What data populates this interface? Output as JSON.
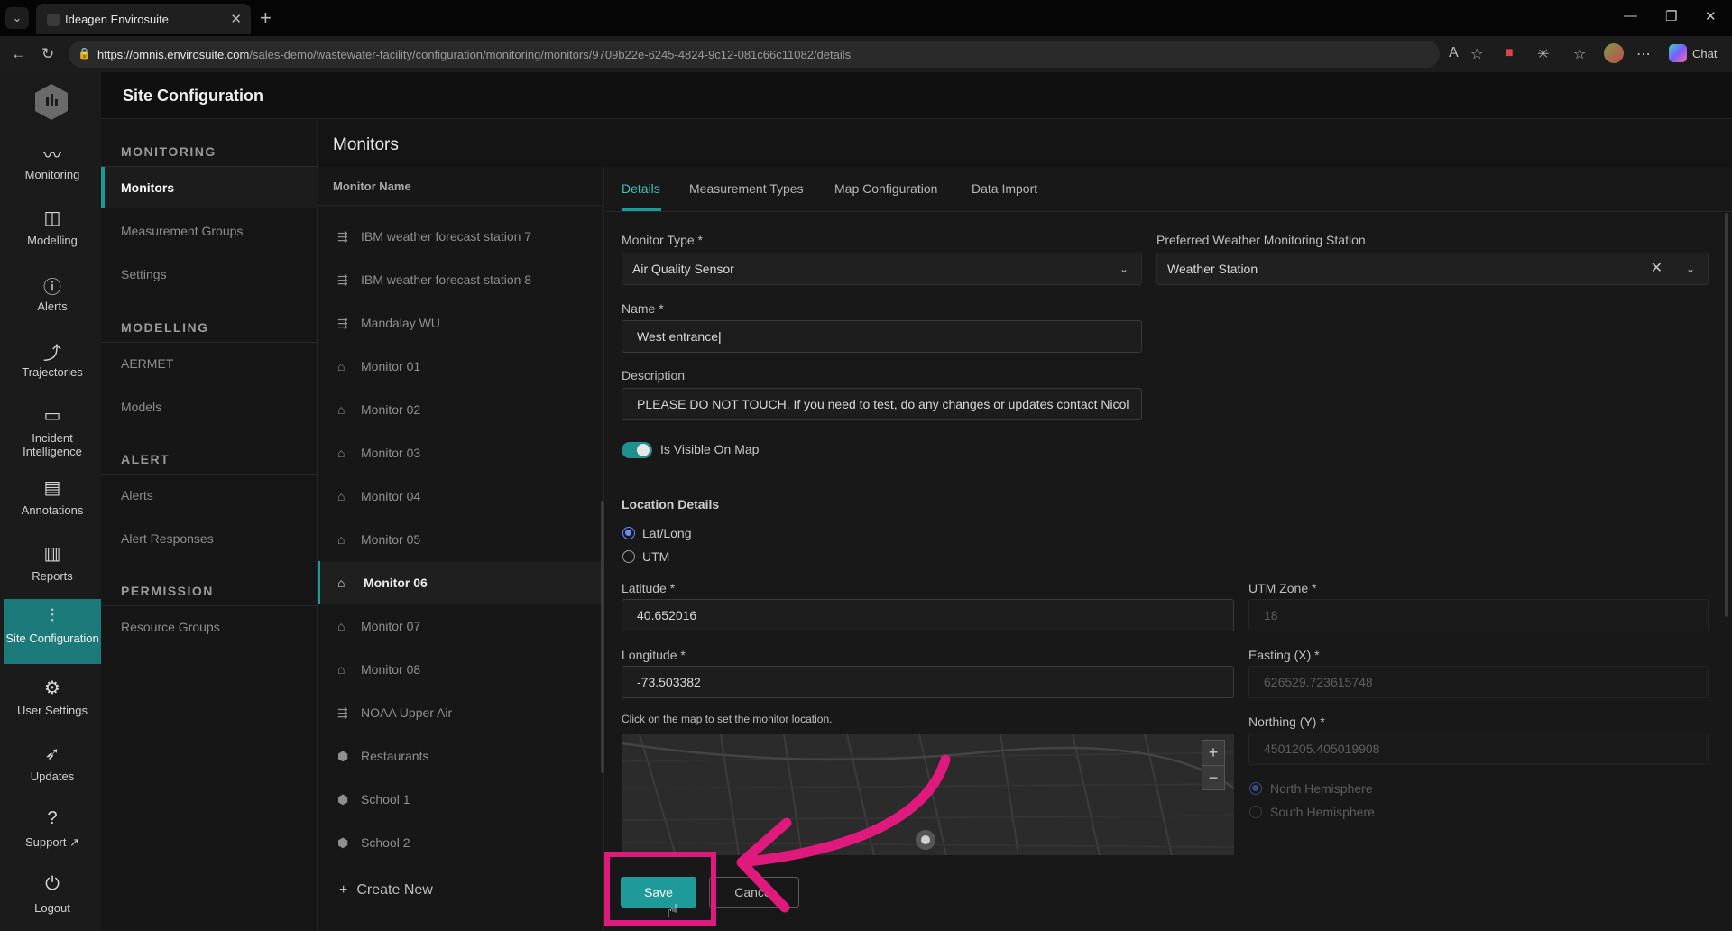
{
  "browser": {
    "tab_title": "Ideagen Envirosuite",
    "url_host": "https://omnis.envirosuite.com",
    "url_path": "/sales-demo/wastewater-facility/configuration/monitoring/monitors/9709b22e-6245-4824-9c12-081c66c11082/details",
    "chat_label": "Chat"
  },
  "rail": {
    "items": [
      {
        "label": "Monitoring",
        "icon": "pulse-icon"
      },
      {
        "label": "Modelling",
        "icon": "modelling-icon"
      },
      {
        "label": "Alerts",
        "icon": "alert-icon"
      },
      {
        "label": "Trajectories",
        "icon": "trajectory-icon"
      },
      {
        "label": "Incident Intelligence",
        "icon": "incident-icon"
      },
      {
        "label": "Annotations",
        "icon": "annotation-icon"
      },
      {
        "label": "Reports",
        "icon": "reports-icon"
      },
      {
        "label": "Site Configuration",
        "icon": "sliders-icon"
      },
      {
        "label": "User Settings",
        "icon": "gear-icon"
      },
      {
        "label": "Updates",
        "icon": "rocket-icon"
      },
      {
        "label": "Support",
        "icon": "help-icon"
      },
      {
        "label": "Logout",
        "icon": "logout-icon"
      }
    ]
  },
  "header": {
    "title": "Site Configuration"
  },
  "sidenav": {
    "monitoring": {
      "title": "MONITORING",
      "items": [
        "Monitors",
        "Measurement Groups",
        "Settings"
      ]
    },
    "modelling": {
      "title": "MODELLING",
      "items": [
        "AERMET",
        "Models"
      ]
    },
    "alert": {
      "title": "ALERT",
      "items": [
        "Alerts",
        "Alert Responses"
      ]
    },
    "permission": {
      "title": "PERMISSION",
      "items": [
        "Resource Groups"
      ]
    }
  },
  "monitors": {
    "title": "Monitors",
    "column": "Monitor Name",
    "items": [
      {
        "name": "IBM weather forecast station 7",
        "icon": "weather-icon"
      },
      {
        "name": "IBM weather forecast station 8",
        "icon": "weather-icon"
      },
      {
        "name": "Mandalay WU",
        "icon": "weather-icon"
      },
      {
        "name": "Monitor 01",
        "icon": "sensor-icon"
      },
      {
        "name": "Monitor 02",
        "icon": "sensor-icon"
      },
      {
        "name": "Monitor 03",
        "icon": "sensor-icon"
      },
      {
        "name": "Monitor 04",
        "icon": "sensor-icon"
      },
      {
        "name": "Monitor 05",
        "icon": "sensor-icon"
      },
      {
        "name": "Monitor 06",
        "icon": "sensor-icon"
      },
      {
        "name": "Monitor 07",
        "icon": "sensor-icon"
      },
      {
        "name": "Monitor 08",
        "icon": "sensor-icon"
      },
      {
        "name": "NOAA Upper Air",
        "icon": "weather-icon"
      },
      {
        "name": "Restaurants",
        "icon": "hexagon-icon"
      },
      {
        "name": "School 1",
        "icon": "hexagon-icon"
      },
      {
        "name": "School 2",
        "icon": "hexagon-icon"
      }
    ],
    "create_new": "Create New"
  },
  "details": {
    "tabs": [
      "Details",
      "Measurement Types",
      "Map Configuration",
      "Data Import"
    ],
    "monitor_type_label": "Monitor Type *",
    "monitor_type_value": "Air Quality Sensor",
    "weather_label": "Preferred Weather Monitoring Station",
    "weather_value": "Weather Station",
    "name_label": "Name *",
    "name_value": "West entrance",
    "description_label": "Description",
    "description_value": "PLEASE DO NOT TOUCH. If you need to test, do any changes or updates contact Nicol",
    "visible_label": "Is Visible On Map",
    "location_title": "Location Details",
    "radio_latlong": "Lat/Long",
    "radio_utm": "UTM",
    "latitude_label": "Latitude *",
    "latitude_value": "40.652016",
    "longitude_label": "Longitude *",
    "longitude_value": "-73.503382",
    "map_hint": "Click on the map to set the monitor location.",
    "utm_zone_label": "UTM Zone *",
    "utm_zone_value": "18",
    "easting_label": "Easting (X) *",
    "easting_value": "626529.723615748",
    "northing_label": "Northing (Y) *",
    "northing_value": "4501205.405019908",
    "north_hemi": "North Hemisphere",
    "south_hemi": "South Hemisphere",
    "save_label": "Save",
    "cancel_label": "Cancel"
  },
  "colors": {
    "accent": "#1f9a9a",
    "highlight": "#e0197d"
  }
}
